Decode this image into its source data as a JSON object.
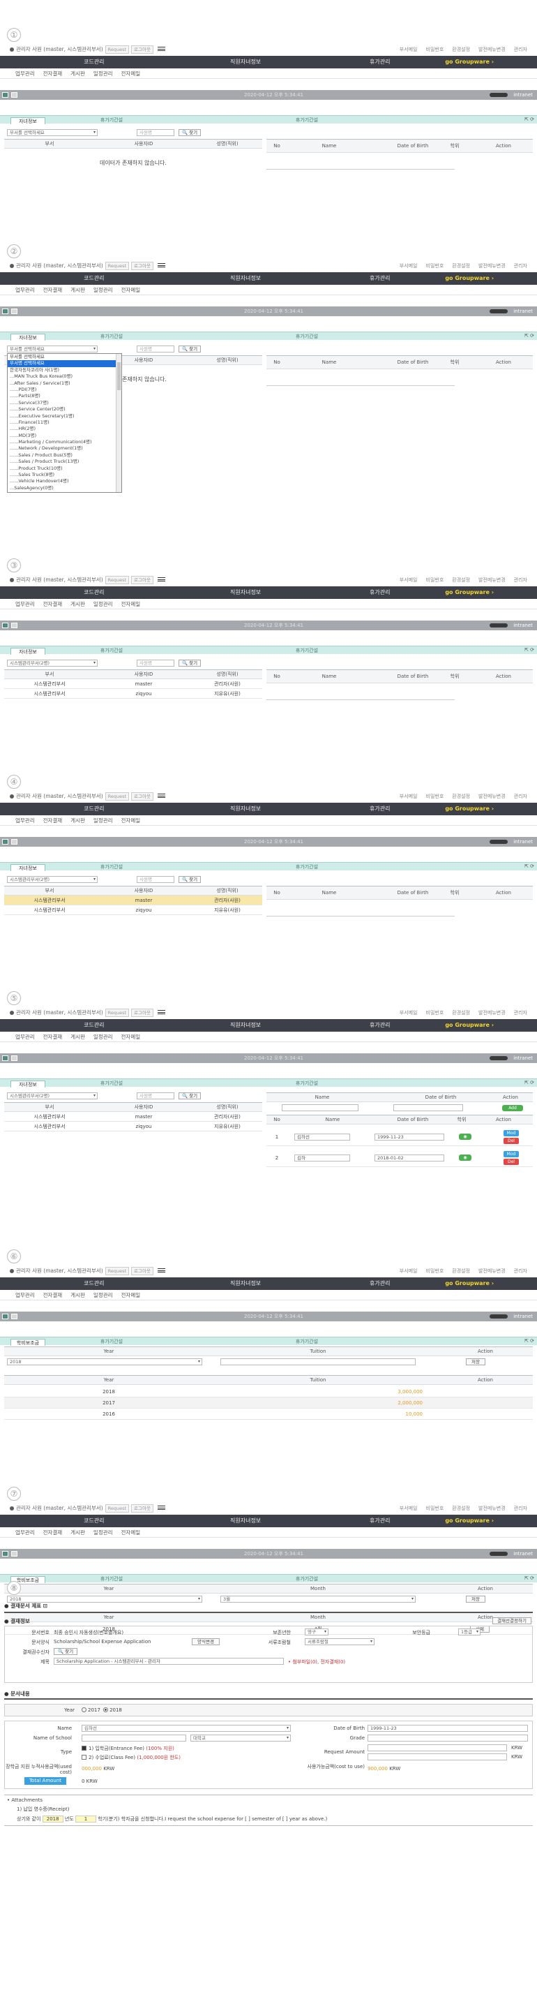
{
  "steps": [
    "①",
    "②",
    "③",
    "④",
    "⑤",
    "⑥",
    "⑦",
    "⑧"
  ],
  "header": {
    "user_text": "관리자 사원 (master, 시스템관리부서)",
    "btn_request": "Request",
    "btn_logout": "로그아웃",
    "links": [
      "부서메일",
      "비밀번호",
      "환경설정",
      "발전메뉴변경",
      "관리자"
    ],
    "nav": [
      "코드관리",
      "직원자녀정보",
      "휴가관리"
    ],
    "go_groupware": "go Groupware ›",
    "subnav": [
      "업무관리",
      "전자결재",
      "게시판",
      "일정관리",
      "전자메일"
    ],
    "datetime": "2020-04-12 오후 5:34:41",
    "intranet": "intranet"
  },
  "tabs": {
    "t1": "자녀정보",
    "t2": "휴가기간설",
    "t3": "휴가기간설",
    "t1b": "학비보조금",
    "icons": "⇱ ⟳"
  },
  "panel": {
    "dept_placeholder": "부서를 선택하세요",
    "dept_selected": "시스템관리부서(2명)",
    "emp_placeholder": "사원명",
    "search_btn": "🔍 찾기",
    "cols_left": [
      "부서",
      "사용자ID",
      "성명(직위)"
    ],
    "cols_right": [
      "No",
      "Name",
      "Date of Birth",
      "학위",
      "Action"
    ],
    "empty_msg": "데이터가 존재하지 않습니다.",
    "rows": [
      {
        "dept": "시스템관리부서",
        "id": "master",
        "name": "관리자(사원)"
      },
      {
        "dept": "시스템관리부서",
        "id": "ziqyou",
        "name": "지유유(사원)"
      }
    ],
    "add_cols": [
      "Name",
      "Date of Birth",
      "Action"
    ],
    "add_btn": "Add",
    "child_cols": [
      "No",
      "Name",
      "Date of Birth",
      "학위",
      "Action"
    ],
    "children": [
      {
        "no": "1",
        "name": "김하선",
        "dob": "1999-11-23",
        "mod": "Mod",
        "del": "Del"
      },
      {
        "no": "2",
        "name": "김하",
        "dob": "2018-01-02",
        "mod": "Mod",
        "del": "Del"
      }
    ]
  },
  "dropdown": {
    "items": [
      "부서를 선택하세요",
      "부서명 선택하세요",
      "한국자동차코리아 사(1명)",
      "...MAN Truck Bus Korea(0명)",
      "...After Sales / Service(1명)",
      "......PDI(7명)",
      "......Parts(8명)",
      "......Service(37명)",
      "......Service Center(20명)",
      "......Executive Secretary(1명)",
      "......Finance(11명)",
      "......HR(2명)",
      "......MD(3명)",
      "......Marketing / Communication(4명)",
      "......Network / Development(1명)",
      "......Sales / Product Bus(5명)",
      "......Sales / Product Truck(13명)",
      "......Product Truck(10명)",
      "......Sales Truck(8명)",
      "......Vehicle Handover(4명)",
      "...SalesAgency(0명)"
    ]
  },
  "tuition": {
    "cols": [
      "Year",
      "Tuition",
      "Action"
    ],
    "year_sel": "2018",
    "save_btn": "저장",
    "rows": [
      {
        "year": "2018",
        "tuition": "3,000,000"
      },
      {
        "year": "2017",
        "tuition": "2,000,000"
      },
      {
        "year": "2016",
        "tuition": "10,000"
      }
    ]
  },
  "monthly": {
    "cols": [
      "Year",
      "Month",
      "Action"
    ],
    "year_sel": "2018",
    "month_sel": "3월",
    "save_btn": "저장",
    "rows": [
      {
        "year": "2018",
        "month": "4월",
        "action": "삭제"
      }
    ]
  },
  "form": {
    "title": "결재문서 제표",
    "sec1": "결재정보",
    "approval_btn": "결재선결정하기",
    "doc_no_lbl": "문서번호",
    "doc_no_val": "최종 승인시 자동생성(번호별개요)",
    "security_lbl": "보존년한",
    "security_val": "영구",
    "grade_lbl": "보안등급",
    "grade_val": "1등급",
    "doc_type_lbl": "문서양식",
    "doc_type_val": "Scholarship/School Expense Application",
    "doc_type_btn": "양식변경",
    "cc_lbl": "서류조람철",
    "cc_val": "서류조람철",
    "approver_lbl": "결재권수신자",
    "approver_btn": "🔍 찾기",
    "subject_lbl": "제목",
    "subject_val": "Scholarship Application - 시스템관리부서 - 관리자",
    "attach_info": "• 첨부파일(0), 전자결재(0)",
    "sec2": "문서내용",
    "year_lbl": "Year",
    "year_opts": [
      "2017",
      "2018"
    ],
    "name_lbl": "Name",
    "name_val": "김하선",
    "dob_lbl": "Date of Birth",
    "dob_val": "1999-11-23",
    "school_lbl": "Name of School",
    "school_type": "대학교",
    "grade2_lbl": "Grade",
    "type_lbl": "Type",
    "type1": "1) 입학금(Entrance Fee)",
    "type1_note": "(100% 지원)",
    "type2": "2) 수업료(Class Fee)",
    "type2_note": "(1,000,000원 한도)",
    "req_lbl": "Request Amount",
    "krw": "KRW",
    "usage_lbl": "장학금 지원 누적사용금액(used cost)",
    "usage_val": "000,000",
    "avail_lbl": "사용가능금액(cost to use)",
    "avail_val": "900,000",
    "total_btn": "Total Amount",
    "total_val": "0 KRW",
    "attach_lbl": "• Attachments",
    "attach1": "1) 납입 영수증(Receipt)",
    "footer_a": "상기와 같이",
    "footer_year": "2018",
    "footer_b": "년도",
    "footer_sem": "1",
    "footer_c": "학기(분기) 학자금을 신청합니다.I request the school expense for [ ] semester of [ ] year as above.)"
  }
}
